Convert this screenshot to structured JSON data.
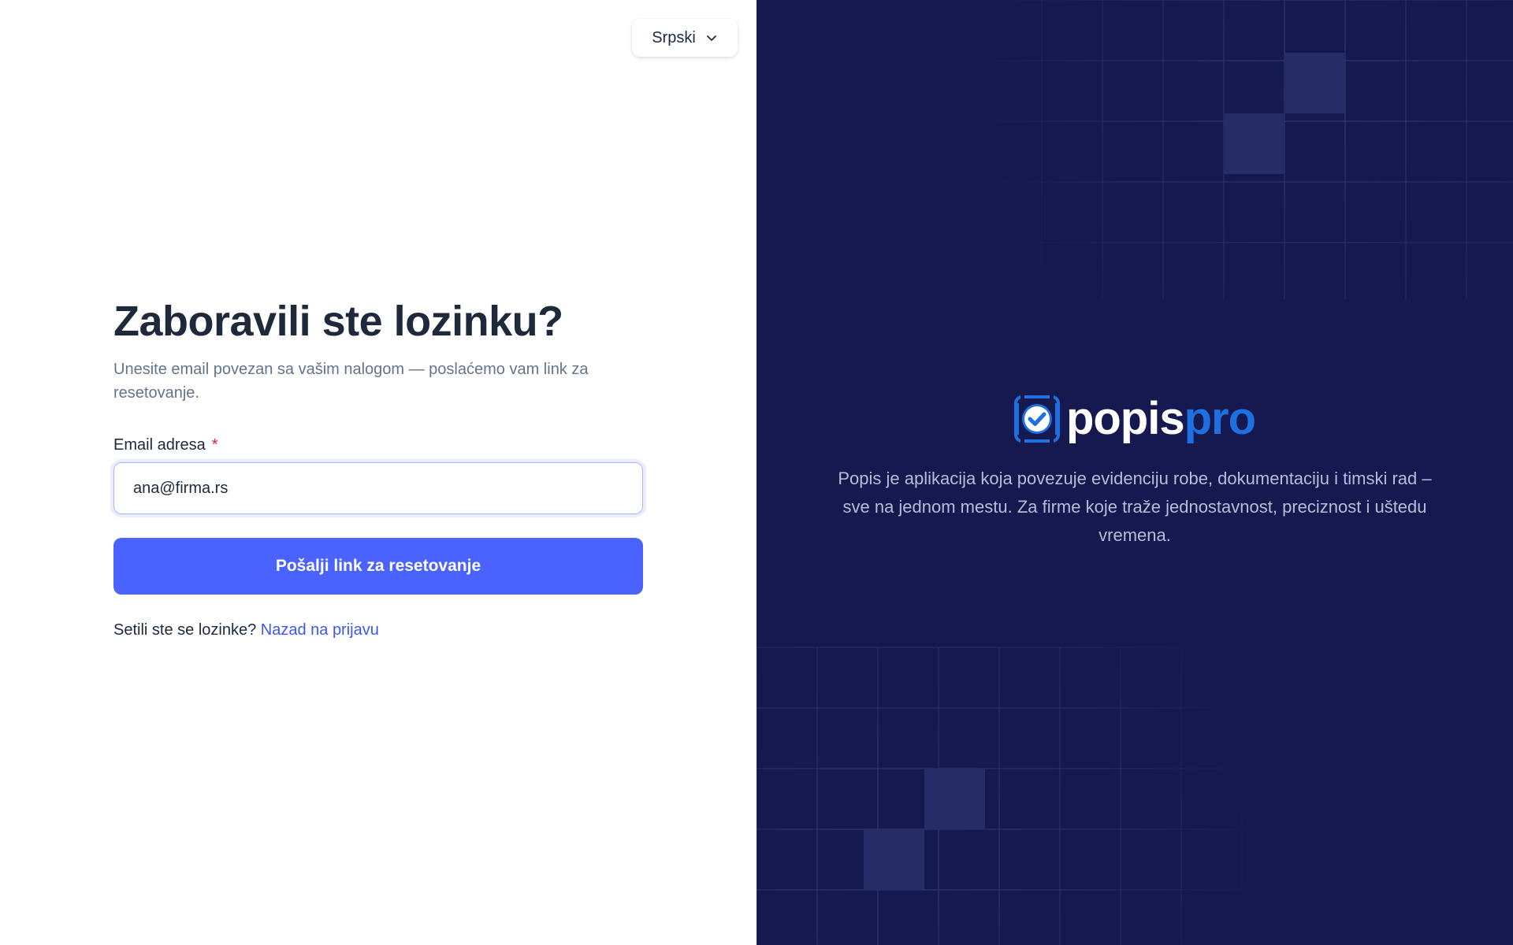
{
  "language": {
    "selected": "Srpski",
    "icon": "chevron-down-icon"
  },
  "form": {
    "title": "Zaboravili ste lozinku?",
    "subtitle": "Unesite email povezan sa vašim nalogom — poslaćemo vam link za resetovanje.",
    "email_label": "Email adresa",
    "required_mark": "*",
    "email_value": "ana@firma.rs",
    "submit_label": "Pošalji link za resetovanje",
    "back_prompt": "Setili ste se lozinke?",
    "back_link": "Nazad na prijavu"
  },
  "brand": {
    "logo_icon": "checkbox-check-icon",
    "logo_part1": "popis",
    "logo_part2": "pro",
    "tagline": "Popis je aplikacija koja povezuje evidenciju robe, dokumentaciju i timski rad – sve na jednom mestu. Za firme koje traže jednostavnost, preciznost i uštedu vremena."
  },
  "colors": {
    "primary_button": "#4a63ff",
    "link": "#3d56f0",
    "panel_background": "#16194f",
    "logo_accent": "#1e6fe0",
    "required": "#e11d48"
  }
}
